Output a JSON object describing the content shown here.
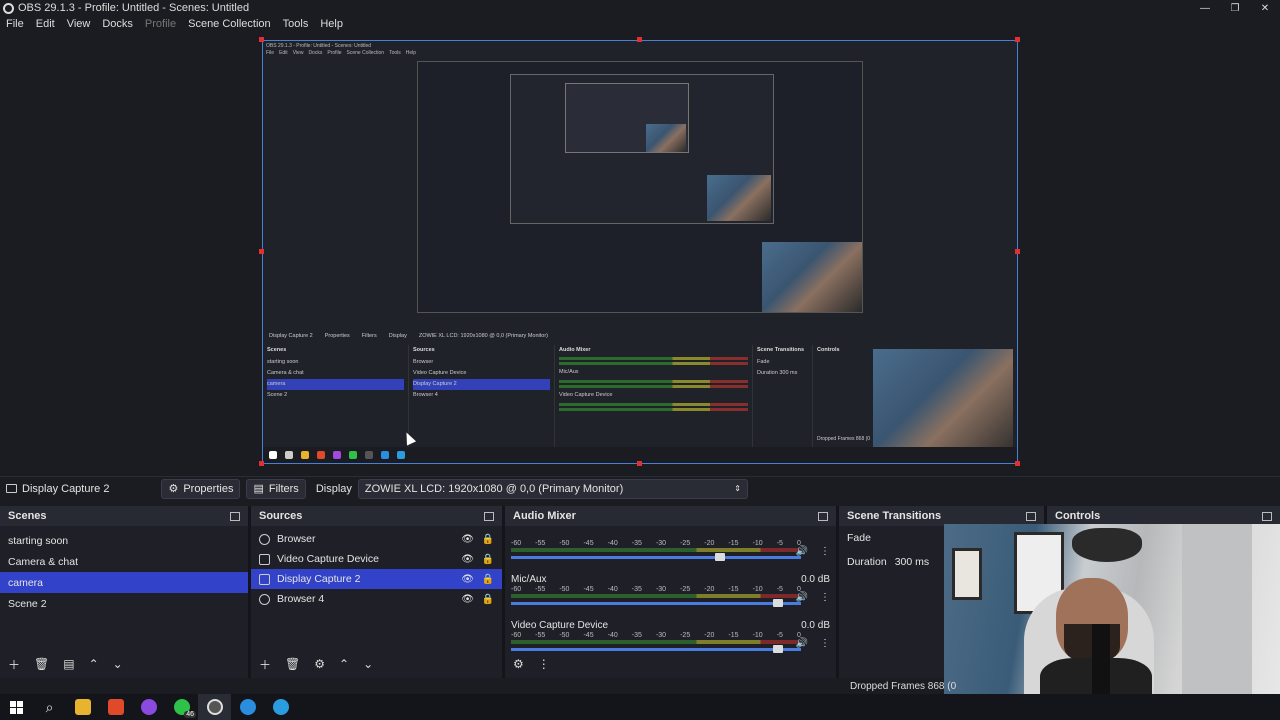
{
  "window": {
    "title": "OBS 29.1.3 - Profile: Untitled - Scenes: Untitled",
    "min": "—",
    "max": "❐",
    "close": "✕"
  },
  "menu": {
    "file": "File",
    "edit": "Edit",
    "view": "View",
    "docks": "Docks",
    "profile": "Profile",
    "scene_collection": "Scene Collection",
    "tools": "Tools",
    "help": "Help"
  },
  "inner": {
    "title": "OBS 29.1.3 - Profile: Untitled - Scenes: Untitled",
    "source_name": "Display Capture 2",
    "properties": "Properties",
    "filters": "Filters",
    "display": "Display",
    "monitor": "ZOWIE XL LCD: 1920x1080 @ 0,0 (Primary Monitor)",
    "scenes_header": "Scenes",
    "sources_header": "Sources",
    "mixer_header": "Audio Mixer",
    "transitions_header": "Scene Transitions",
    "controls_header": "Controls",
    "scenes": [
      "starting soon",
      "Camera & chat",
      "camera",
      "Scene 2"
    ],
    "sources": [
      "Browser",
      "Video Capture Device",
      "Display Capture 2",
      "Browser 4"
    ],
    "mic": "Mic/Aux",
    "vcd": "Video Capture Device",
    "fade": "Fade",
    "duration": "Duration",
    "duration_val": "300 ms",
    "db": "0.0 dB",
    "dropped": "Dropped Frames 868 (0"
  },
  "sourcebar": {
    "source_name": "Display Capture 2",
    "properties": "Properties",
    "filters": "Filters",
    "display_label": "Display",
    "display_value": "ZOWIE XL LCD: 1920x1080 @ 0,0 (Primary Monitor)"
  },
  "scenes": {
    "header": "Scenes",
    "items": [
      "starting soon",
      "Camera & chat",
      "camera",
      "Scene 2"
    ],
    "selected": "camera"
  },
  "sources": {
    "header": "Sources",
    "items": [
      "Browser",
      "Video Capture Device",
      "Display Capture 2",
      "Browser 4"
    ],
    "selected": "Display Capture 2"
  },
  "mixer": {
    "header": "Audio Mixer",
    "scale": [
      "-60",
      "-55",
      "-50",
      "-45",
      "-40",
      "-35",
      "-30",
      "-25",
      "-20",
      "-15",
      "-10",
      "-5",
      "0"
    ],
    "channels": [
      {
        "name": "",
        "db": "",
        "fader": 0.72
      },
      {
        "name": "Mic/Aux",
        "db": "0.0 dB",
        "fader": 0.92
      },
      {
        "name": "Video Capture Device",
        "db": "0.0 dB",
        "fader": 0.92
      }
    ]
  },
  "transitions": {
    "header": "Scene Transitions",
    "type": "Fade",
    "duration_label": "Duration",
    "duration_value": "300 ms"
  },
  "controls": {
    "header": "Controls"
  },
  "status": {
    "dropped_frames": "Dropped Frames 868 (0"
  },
  "colors": {
    "accent": "#3242c9",
    "selection_border": "#4a7fd8",
    "handle": "#e03030"
  },
  "taskbar": {
    "icons": [
      "windows-start-icon",
      "search-icon",
      "file-explorer-icon",
      "brave-browser-icon",
      "messenger-icon",
      "whatsapp-icon",
      "obs-icon",
      "edge-icon",
      "edge-icon-2"
    ],
    "whatsapp_badge": "46"
  }
}
